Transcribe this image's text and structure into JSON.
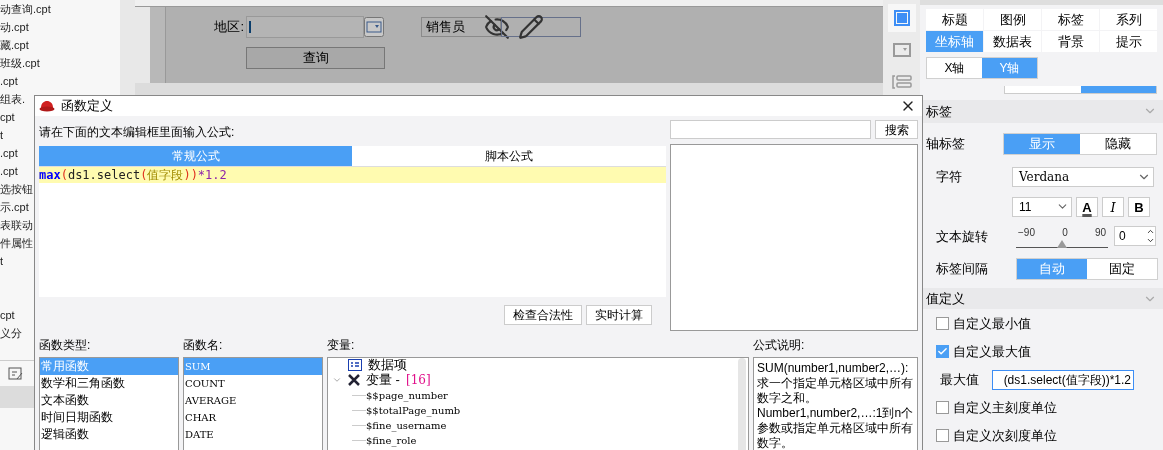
{
  "file_list": {
    "upper": [
      "动查询.cpt",
      "动.cpt",
      "藏.cpt",
      "班级.cpt",
      ".cpt"
    ],
    "lower": [
      "组表.",
      "cpt",
      "t",
      ".cpt",
      ".cpt",
      "选按钮",
      "示.cpt",
      "表联动",
      "件属性",
      "t"
    ],
    "bottom": [
      "cpt",
      "义分"
    ]
  },
  "designer": {
    "region_label": "地区:",
    "query_button": "查询",
    "salesperson_label": "销售员"
  },
  "side_tools": [
    {
      "kind": "frame",
      "selected": true
    },
    {
      "kind": "dropdown",
      "selected": false
    },
    {
      "kind": "layout",
      "selected": false
    }
  ],
  "chart_panel": {
    "tabs": [
      {
        "label": "标题",
        "selected": false
      },
      {
        "label": "图例",
        "selected": false
      },
      {
        "label": "标签",
        "selected": false
      },
      {
        "label": "系列",
        "selected": false
      },
      {
        "label": "坐标轴",
        "selected": true
      },
      {
        "label": "数据表",
        "selected": false
      },
      {
        "label": "背景",
        "selected": false
      },
      {
        "label": "提示",
        "selected": false
      }
    ],
    "axis_tabs": [
      {
        "label": "X轴",
        "selected": false
      },
      {
        "label": "Y轴",
        "selected": true
      }
    ],
    "label_section": {
      "title": "标签",
      "axis_label": "轴标签",
      "visibility": [
        {
          "label": "显示",
          "selected": true
        },
        {
          "label": "隐藏",
          "selected": false
        }
      ],
      "font_label": "字符",
      "font": "Verdana",
      "size": "11",
      "style_buttons": [
        {
          "kind": "color",
          "text": "A"
        },
        {
          "kind": "italic",
          "text": "I"
        },
        {
          "kind": "bold",
          "text": "B"
        }
      ],
      "rotation_label": "文本旋转",
      "rotation": {
        "ticks": [
          "−90",
          "0",
          "90"
        ],
        "level": 0.5,
        "value": "0"
      },
      "interval_label": "标签间隔",
      "interval": [
        {
          "label": "自动",
          "selected": true
        },
        {
          "label": "固定",
          "selected": false
        }
      ]
    },
    "value_section": {
      "title": "值定义",
      "items": [
        {
          "kind": "checkbox",
          "label": "自定义最小值",
          "checked": false
        },
        {
          "kind": "checkbox",
          "label": "自定义最大值",
          "checked": true
        },
        {
          "kind": "field",
          "label": "最大值",
          "value": "(ds1.select(值字段))*1.2"
        },
        {
          "kind": "checkbox",
          "label": "自定义主刻度单位",
          "checked": false
        },
        {
          "kind": "checkbox",
          "label": "自定义次刻度单位",
          "checked": false
        }
      ]
    }
  },
  "dialog": {
    "title": "函数定义",
    "prompt": "请在下面的文本编辑框里面输入公式:",
    "tabs": [
      {
        "label": "常规公式",
        "selected": true
      },
      {
        "label": "脚本公式",
        "selected": false
      }
    ],
    "formula": [
      {
        "kind": "function",
        "text": "max"
      },
      {
        "kind": "paren",
        "text": "("
      },
      {
        "kind": "name",
        "text": "ds1.select"
      },
      {
        "kind": "paren",
        "text": "("
      },
      {
        "kind": "field",
        "text": "值字段"
      },
      {
        "kind": "paren",
        "text": "))"
      },
      {
        "kind": "number",
        "text": "*1.2"
      }
    ],
    "buttons": [
      "检查合法性",
      "实时计算"
    ],
    "search_button": "搜索",
    "type_heading": "函数类型:",
    "types": [
      {
        "label": "常用函数",
        "selected": true
      },
      {
        "label": "数学和三角函数",
        "selected": false
      },
      {
        "label": "文本函数",
        "selected": false
      },
      {
        "label": "时间日期函数",
        "selected": false
      },
      {
        "label": "逻辑函数",
        "selected": false
      }
    ],
    "name_heading": "函数名:",
    "names": [
      {
        "label": "SUM",
        "selected": true
      },
      {
        "label": "COUNT",
        "selected": false
      },
      {
        "label": "AVERAGE",
        "selected": false
      },
      {
        "label": "CHAR",
        "selected": false
      },
      {
        "label": "DATE",
        "selected": false
      }
    ],
    "var_heading": "变量:",
    "variables": [
      {
        "kind": "item",
        "label": "数据项"
      },
      {
        "kind": "group",
        "label": "变量 -",
        "count": "[16]",
        "expanded": true,
        "children": [
          {
            "label": "$$page_number"
          },
          {
            "label": "$$totalPage_numb"
          },
          {
            "label": "$fine_username"
          },
          {
            "label": "$fine_role"
          }
        ]
      }
    ],
    "desc_heading": "公式说明:",
    "description": [
      "SUM(number1,number2,…):求一个指定单元格区域中所有数字之和。",
      "Number1,number2,…:1到n个参数或指定单元格区域中所有数字。"
    ]
  }
}
